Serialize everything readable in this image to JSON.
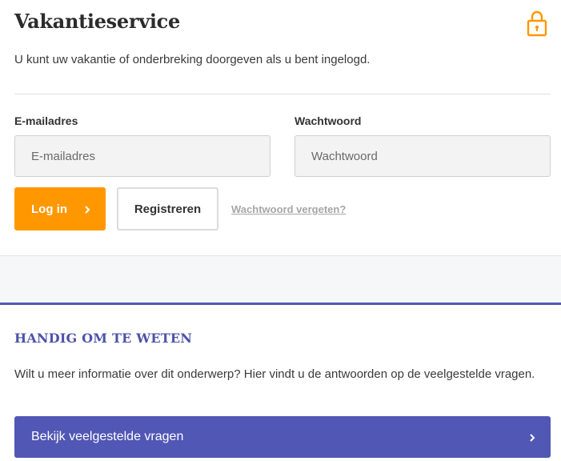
{
  "header": {
    "title": "Vakantieservice",
    "intro": "U kunt uw vakantie of onderbreking doorgeven als u bent ingelogd.",
    "icon": "lock-icon"
  },
  "login_form": {
    "email_label": "E-mailadres",
    "email_placeholder": "E-mailadres",
    "email_value": "",
    "password_label": "Wachtwoord",
    "password_placeholder": "Wachtwoord",
    "password_value": "",
    "login_button": "Log in",
    "register_button": "Registreren",
    "forgot_link": "Wachtwoord vergeten?"
  },
  "faq": {
    "heading": "HANDIG OM TE WETEN",
    "text": "Wilt u meer informatie over dit onderwerp? Hier vindt u de antwoorden op de veelgestelde vragen.",
    "button": "Bekijk veelgestelde vragen"
  },
  "colors": {
    "accent_orange": "#ff9800",
    "accent_purple": "#5157b5",
    "heading_purple": "#4c52a8"
  }
}
